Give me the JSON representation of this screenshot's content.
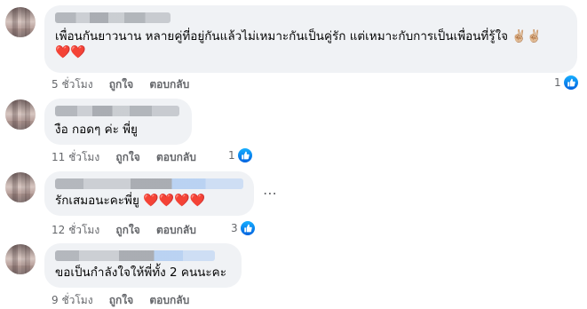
{
  "comments": [
    {
      "text": "เพื่อนกันยาวนาน หลายคู่ที่อยู่กันแล้วไม่เหมาะกันเป็นคู่รัก แต่เหมาะกับการเป็นเพื่อนที่รู้ใจ ✌🏼✌🏼",
      "hearts": "❤️❤️",
      "time": "5 ชั่วโมง",
      "like": "ถูกใจ",
      "reply": "ตอบกลับ",
      "reactions": "1"
    },
    {
      "text": "งือ กอดๆ ค่ะ พี่ยู",
      "hearts": "",
      "time": "11 ชั่วโมง",
      "like": "ถูกใจ",
      "reply": "ตอบกลับ",
      "reactions": "1"
    },
    {
      "text": "รักเสมอนะคะพี่ยู",
      "hearts": "❤️❤️❤️❤️",
      "time": "12 ชั่วโมง",
      "like": "ถูกใจ",
      "reply": "ตอบกลับ",
      "reactions": "3"
    },
    {
      "text": "ขอเป็นกำลังใจให้พี่ทั้ง 2 คนนะคะ",
      "hearts": "",
      "time": "9 ชั่วโมง",
      "like": "ถูกใจ",
      "reply": "ตอบกลับ",
      "reactions": ""
    }
  ],
  "more_icon": "more-horizontal-icon",
  "like_icon": "thumbs-up-icon",
  "colors": {
    "bubble": "#f0f2f5",
    "secondary_text": "#65676b",
    "like_blue": "#1877f2",
    "heart_red": "#f0284a"
  }
}
